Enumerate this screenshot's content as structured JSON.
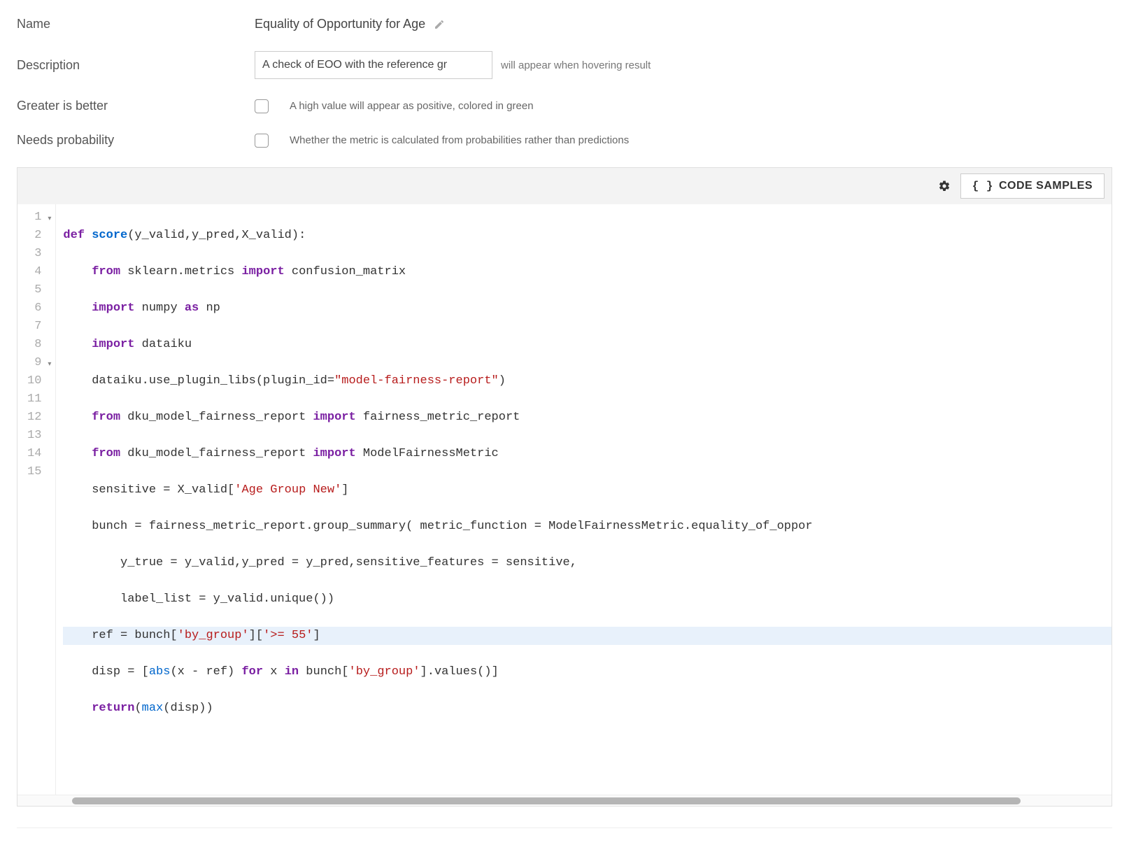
{
  "form": {
    "name_label": "Name",
    "name_value": "Equality of Opportunity for Age",
    "desc_label": "Description",
    "desc_value": "A check of EOO with the reference gr",
    "desc_hint": "will appear when hovering result",
    "gib_label": "Greater is better",
    "gib_hint": "A high value will appear as positive, colored in green",
    "np_label": "Needs probability",
    "np_hint": "Whether the metric is calculated from probabilities rather than predictions"
  },
  "toolbar": {
    "code_samples": "CODE SAMPLES"
  },
  "code": {
    "lines": [
      {
        "n": "1",
        "fold": true
      },
      {
        "n": "2"
      },
      {
        "n": "3"
      },
      {
        "n": "4"
      },
      {
        "n": "5"
      },
      {
        "n": "6"
      },
      {
        "n": "7"
      },
      {
        "n": "8"
      },
      {
        "n": "9",
        "fold": true
      },
      {
        "n": "10"
      },
      {
        "n": "11"
      },
      {
        "n": "12",
        "hl": true
      },
      {
        "n": "13"
      },
      {
        "n": "14"
      },
      {
        "n": "15"
      }
    ],
    "l1_def": "def",
    "l1_name": "score",
    "l1_rest": "(y_valid,y_pred,X_valid):",
    "l2_from": "from",
    "l2_mod": " sklearn.metrics ",
    "l2_imp": "import",
    "l2_rest": " confusion_matrix",
    "l3_imp": "import",
    "l3_mod": " numpy ",
    "l3_as": "as",
    "l3_np": " np",
    "l4_imp": "import",
    "l4_rest": " dataiku",
    "l5_a": "    dataiku.use_plugin_libs(plugin_id=",
    "l5_str": "\"model-fairness-report\"",
    "l5_b": ")",
    "l6_from": "from",
    "l6_mod": " dku_model_fairness_report ",
    "l6_imp": "import",
    "l6_rest": " fairness_metric_report",
    "l7_from": "from",
    "l7_mod": " dku_model_fairness_report ",
    "l7_imp": "import",
    "l7_rest": " ModelFairnessMetric",
    "l8_a": "    sensitive = X_valid[",
    "l8_str": "'Age Group New'",
    "l8_b": "]",
    "l9": "    bunch = fairness_metric_report.group_summary( metric_function = ModelFairnessMetric.equality_of_oppor",
    "l10": "        y_true = y_valid,y_pred = y_pred,sensitive_features = sensitive,",
    "l11": "        label_list = y_valid.unique())",
    "l12_a": "    ref = bunch[",
    "l12_s1": "'by_group'",
    "l12_b": "][",
    "l12_s2": "'>= 55'",
    "l12_c": "]",
    "l13_a": "    disp = [",
    "l13_abs": "abs",
    "l13_b": "(x - ref) ",
    "l13_for": "for",
    "l13_c": " x ",
    "l13_in": "in",
    "l13_d": " bunch[",
    "l13_str": "'by_group'",
    "l13_e": "].values()]",
    "l14_ret": "return",
    "l14_a": "(",
    "l14_max": "max",
    "l14_b": "(disp))"
  }
}
